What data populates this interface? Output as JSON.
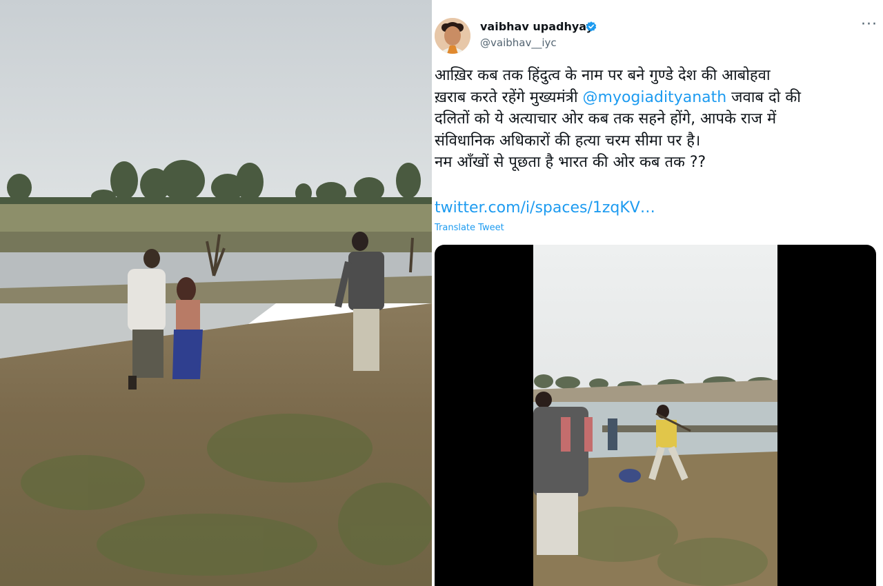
{
  "tweet": {
    "display_name": "vaibhav upadhyay",
    "handle": "@vaibhav__iyc",
    "more_label": "···",
    "text_lines": [
      "आख़िर कब तक हिंदुत्व के नाम पर बने गुण्डे देश की आबोहवा",
      "ख़राब करते रहेंगे मुख्यमंत्री ",
      "दलितों को ये अत्याचार ओर कब तक सहने होंगे, आपके राज में",
      "संविधानिक अधिकारों की हत्या चरम सीमा पर है।",
      "नम आँखों से पूछता है भारत की ओर कब तक ??"
    ],
    "mention": "@myogiadityanath",
    "text_after_mention": " जवाब दो की",
    "link": "twitter.com/i/spaces/1zqKV…",
    "translate_label": "Translate Tweet"
  },
  "icons": {
    "verified": "verified-badge-icon",
    "more": "more-horizontal-icon"
  },
  "colors": {
    "link": "#1d9bf0",
    "text": "#0f1419",
    "muted": "#536471"
  }
}
